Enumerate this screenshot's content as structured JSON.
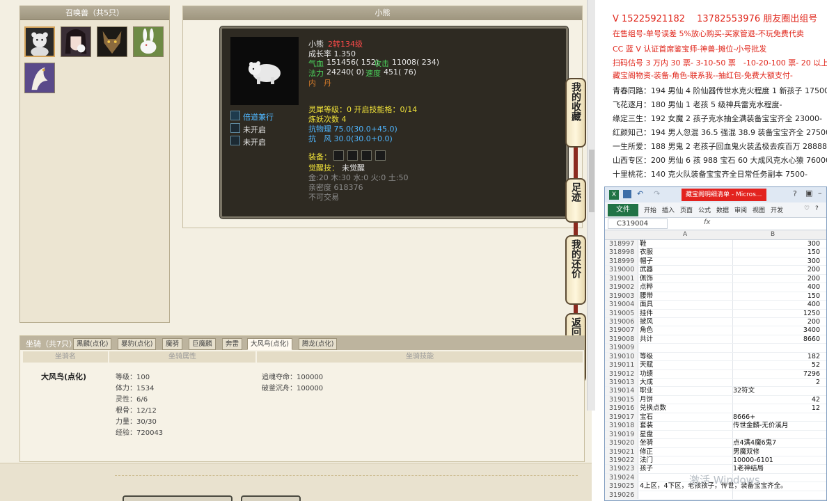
{
  "summon": {
    "header": "召唤兽（共5只）"
  },
  "detail": {
    "header": "小熊",
    "name": "小熊",
    "level": "2转134级",
    "growth": "成长率 1.350",
    "hp_label": "气血",
    "hp_value": "151456( 152)",
    "atk_label": "攻击",
    "atk_value": "11008( 234)",
    "mp_label": "法力",
    "mp_value": "24240( 0)",
    "spd_label": "速度",
    "spd_value": "451( 76)",
    "inner": "内　丹",
    "skill1": "倍道兼行",
    "skill2": "未开启",
    "skill3": "未开启",
    "spirit": "灵犀等级：0 开启技能格：0/14",
    "refine": "炼妖次数 4",
    "resist_phys": "抗物理 75.0(30.0+45.0)",
    "resist_wind": "抗　风 30.0(30.0+0.0)",
    "equip_label": "装备：",
    "awaken_label": "觉醒技：",
    "awaken_value": "未觉醒",
    "elements": "金:20 木:30 水:0 火:0 土:50",
    "intimacy": "亲密度 618376",
    "trade": "不可交易"
  },
  "side_tabs": [
    {
      "label": "我的收藏"
    },
    {
      "label": "足迹"
    },
    {
      "label": "我的还价"
    },
    {
      "label": "返回顶部"
    }
  ],
  "mount": {
    "title": "坐骑（共7只）",
    "tabs": [
      "黑麟(点化)",
      "暴豹(点化)",
      "魔骑",
      "巨魔麟",
      "奔雷",
      "大风鸟(点化)",
      "腾龙(点化)"
    ],
    "col_name": "坐骑名",
    "col_attr": "坐骑属性",
    "col_skill": "坐骑技能",
    "selected_name": "大风鸟(点化)",
    "attrs": [
      "等级：100",
      "体力：1534",
      "灵性：6/6",
      "根骨：12/12",
      "力量：30/30",
      "经验：720043"
    ],
    "skills": [
      "追魂夺命：100000",
      "破釜沉舟：100000"
    ]
  },
  "ads": [
    {
      "text": "V 15225921182　 13782553976 朋友圈出组号",
      "color": "#e0261b",
      "size": 13
    },
    {
      "text": "在售组号-单号误差 5%放心购买-买家管退-不玩免费代卖",
      "color": "#e0261b",
      "size": 11
    },
    {
      "text": "CC 蓝 V 认证首席鉴宝师-神兽-摊位-小号批发",
      "color": "#e0261b",
      "size": 11
    },
    {
      "text": "扫码估号 3 万内 30 票- 3-10-50 票　-10-20-100 票- 20 以上 150",
      "color": "#e0261b",
      "size": 11
    },
    {
      "text": "藏宝阁物资-装备-角色-联系我--抽红包-免费大额支付-",
      "color": "#e0261b",
      "size": 11
    },
    {
      "text": "青春同路：194 男仙 4 阶仙器传世水克火程度 1 新孩子 17500",
      "color": "#222222",
      "size": 11
    },
    {
      "text": "飞花逐月：180 男仙 1 老孩 5 级神兵雷克水程度-",
      "color": "#222222",
      "size": 11
    },
    {
      "text": "缘定三生：192 女魔 2 孩子克水抽全满装备宝宝齐全 23000-",
      "color": "#222222",
      "size": 11
    },
    {
      "text": "红颜知己：194 男人忽混 36.5 强混 38.9 装备宝宝齐全 27500-",
      "color": "#222222",
      "size": 11
    },
    {
      "text": "一生所爱：188 男鬼 2 老孩子回血鬼火装孟极去疾百万 28888",
      "color": "#222222",
      "size": 11
    },
    {
      "text": "山西专区：200 男仙 6 孩 988 宝石 60 大成风克水心猿 76000-",
      "color": "#222222",
      "size": 11
    },
    {
      "text": "十里桃花：140 克火队装备宝宝齐全日常任务副本 7500-",
      "color": "#222222",
      "size": 11
    }
  ],
  "excel": {
    "name_tab": "藏宝阁明细清单 - Micros...",
    "file_label": "文件",
    "ribbon_tabs": [
      "开始",
      "插入",
      "页面",
      "公式",
      "数据",
      "审阅",
      "视图",
      "开发"
    ],
    "namebox": "C319004",
    "fx": "fx",
    "col_a": "A",
    "col_b": "B",
    "rows": [
      {
        "n": "318997",
        "a": "鞋",
        "b": "300",
        "num": true
      },
      {
        "n": "318998",
        "a": "衣服",
        "b": "150",
        "num": true
      },
      {
        "n": "318999",
        "a": "帽子",
        "b": "300",
        "num": true
      },
      {
        "n": "319000",
        "a": "武器",
        "b": "200",
        "num": true
      },
      {
        "n": "319001",
        "a": "佩饰",
        "b": "200",
        "num": true
      },
      {
        "n": "319002",
        "a": "点粹",
        "b": "400",
        "num": true
      },
      {
        "n": "319003",
        "a": "腰带",
        "b": "150",
        "num": true
      },
      {
        "n": "319004",
        "a": "面具",
        "b": "400",
        "num": true
      },
      {
        "n": "319005",
        "a": "挂件",
        "b": "1250",
        "num": true
      },
      {
        "n": "319006",
        "a": "披风",
        "b": "200",
        "num": true
      },
      {
        "n": "319007",
        "a": "角色",
        "b": "3400",
        "num": true
      },
      {
        "n": "319008",
        "a": "共计",
        "b": "8660",
        "num": true
      },
      {
        "n": "319009",
        "a": "",
        "b": "",
        "num": true
      },
      {
        "n": "319010",
        "a": "等级",
        "b": "182",
        "num": true
      },
      {
        "n": "319011",
        "a": "天赋",
        "b": "52",
        "num": true
      },
      {
        "n": "319012",
        "a": "功绩",
        "b": "7296",
        "num": true
      },
      {
        "n": "319013",
        "a": "大成",
        "b": "2",
        "num": true
      },
      {
        "n": "319014",
        "a": "职业",
        "b": "32符文",
        "num": false
      },
      {
        "n": "319015",
        "a": "月饼",
        "b": "42",
        "num": true
      },
      {
        "n": "319016",
        "a": "兑换点数",
        "b": "12",
        "num": true
      },
      {
        "n": "319017",
        "a": "宝石",
        "b": "8666+",
        "num": false
      },
      {
        "n": "319018",
        "a": "套装",
        "b": "传世金麟-无价溪月",
        "num": false
      },
      {
        "n": "319019",
        "a": "星盘",
        "b": "",
        "num": false
      },
      {
        "n": "319020",
        "a": "坐骑",
        "b": "点4满4魔6鬼7",
        "num": false
      },
      {
        "n": "319021",
        "a": "修正",
        "b": "男魔双修",
        "num": false
      },
      {
        "n": "319022",
        "a": "法门",
        "b": "10000-6101",
        "num": false
      },
      {
        "n": "319023",
        "a": "孩子",
        "b": "1老神结局",
        "num": false
      },
      {
        "n": "319024",
        "a": "",
        "b": "",
        "num": false
      },
      {
        "n": "319025",
        "a": "4上区，4下区，老孩孩子，传世，装备宝宝齐全。",
        "b": "",
        "num": false
      },
      {
        "n": "319026",
        "a": "",
        "b": "",
        "num": false
      }
    ]
  },
  "watermark": "激活 Windows",
  "colors": {
    "accent_red": "#e0261b",
    "excel_green": "#217346",
    "game_dark": "#2e2a22"
  }
}
